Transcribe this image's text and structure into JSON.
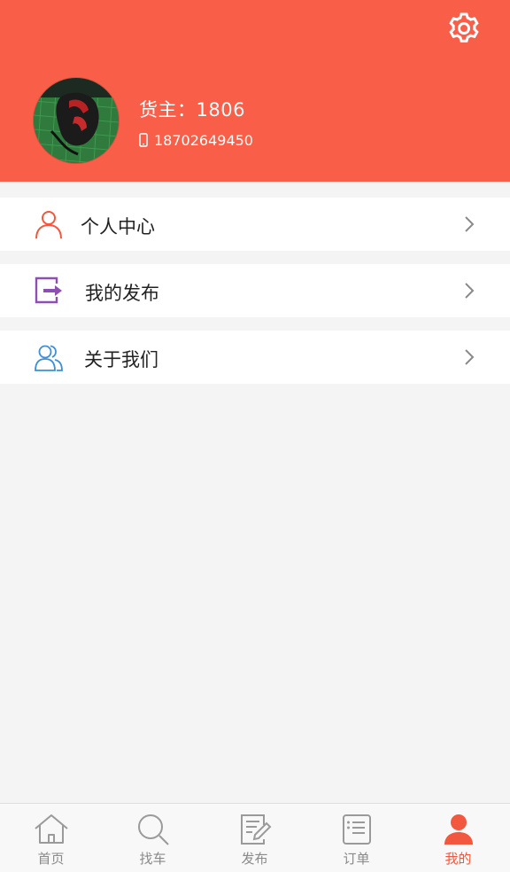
{
  "header": {
    "settings_icon": "gear-icon",
    "user_name": "货主：1806",
    "phone": "18702649450",
    "phone_icon": "mobile-phone-icon",
    "background_color": "#f85e48"
  },
  "menu": {
    "items": [
      {
        "label": "个人中心",
        "icon": "person-icon",
        "icon_color": "#f1583f"
      },
      {
        "label": "我的发布",
        "icon": "publish-icon",
        "icon_color": "#8e4fb3"
      },
      {
        "label": "关于我们",
        "icon": "group-icon",
        "icon_color": "#3d8fd6"
      }
    ],
    "chevron_icon": "chevron-right-icon"
  },
  "tabbar": {
    "tabs": [
      {
        "label": "首页",
        "icon": "home-icon",
        "active": false
      },
      {
        "label": "找车",
        "icon": "search-icon",
        "active": false
      },
      {
        "label": "发布",
        "icon": "edit-document-icon",
        "active": false
      },
      {
        "label": "订单",
        "icon": "order-list-icon",
        "active": false
      },
      {
        "label": "我的",
        "icon": "profile-icon",
        "active": true
      }
    ],
    "active_color": "#f1583f",
    "inactive_color": "#8a8a8a"
  }
}
